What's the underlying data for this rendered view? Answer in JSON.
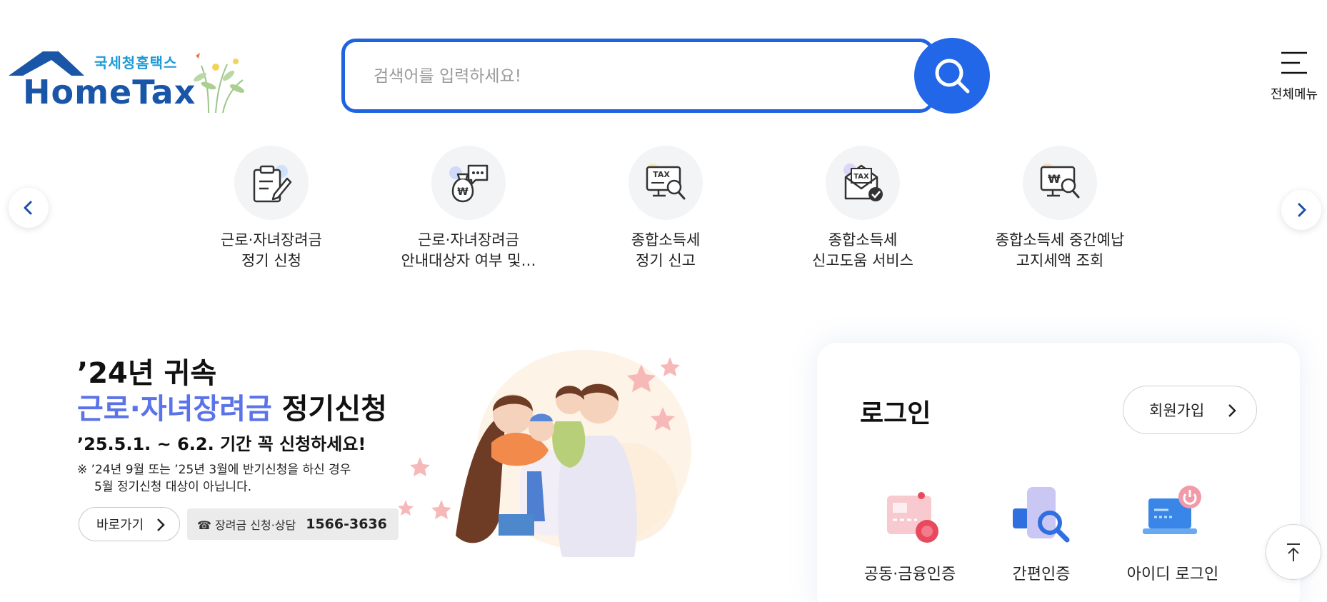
{
  "header": {
    "logo_subtitle": "국세청홈택스",
    "logo_title": "HomeTax",
    "search_placeholder": "검색어를 입력하세요!",
    "menu_label": "전체메뉴"
  },
  "quick_services": [
    {
      "line1": "근로·자녀장려금",
      "line2": "정기 신청",
      "icon": "clipboard-pen-icon"
    },
    {
      "line1": "근로·자녀장려금",
      "line2": "안내대상자 여부 및…",
      "icon": "money-bag-chat-icon"
    },
    {
      "line1": "종합소득세",
      "line2": "정기 신고",
      "icon": "tax-monitor-search-icon"
    },
    {
      "line1": "종합소득세",
      "line2": "신고도움 서비스",
      "icon": "tax-envelope-check-icon"
    },
    {
      "line1": "종합소득세 중간예납",
      "line2": "고지세액 조회",
      "icon": "won-monitor-search-icon"
    }
  ],
  "banner": {
    "line1": "’24년 귀속",
    "line2_highlight": "근로·자녀장려금",
    "line2_rest": " 정기신청",
    "line3": "’25.5.1. ~ 6.2. 기간 꼭 신청하세요!",
    "note_line1": "※ ’24년 9월 또는 ’25년 3월에 반기신청을 하신 경우",
    "note_line2": "5월 정기신청 대상이 아닙니다.",
    "go_label": "바로가기",
    "phone_label": "☎ 장려금 신청·상담",
    "phone_number": "1566-3636"
  },
  "login": {
    "title": "로그인",
    "join_label": "회원가입",
    "methods": [
      {
        "label": "공동·금융인증",
        "icon": "certificate-card-icon"
      },
      {
        "label": "간편인증",
        "icon": "phone-search-icon"
      },
      {
        "label": "아이디 로그인",
        "icon": "laptop-power-icon"
      }
    ]
  },
  "colors": {
    "brand_blue": "#1a56a8",
    "search_blue": "#2167e8",
    "highlight_purple": "#5b73e8"
  }
}
